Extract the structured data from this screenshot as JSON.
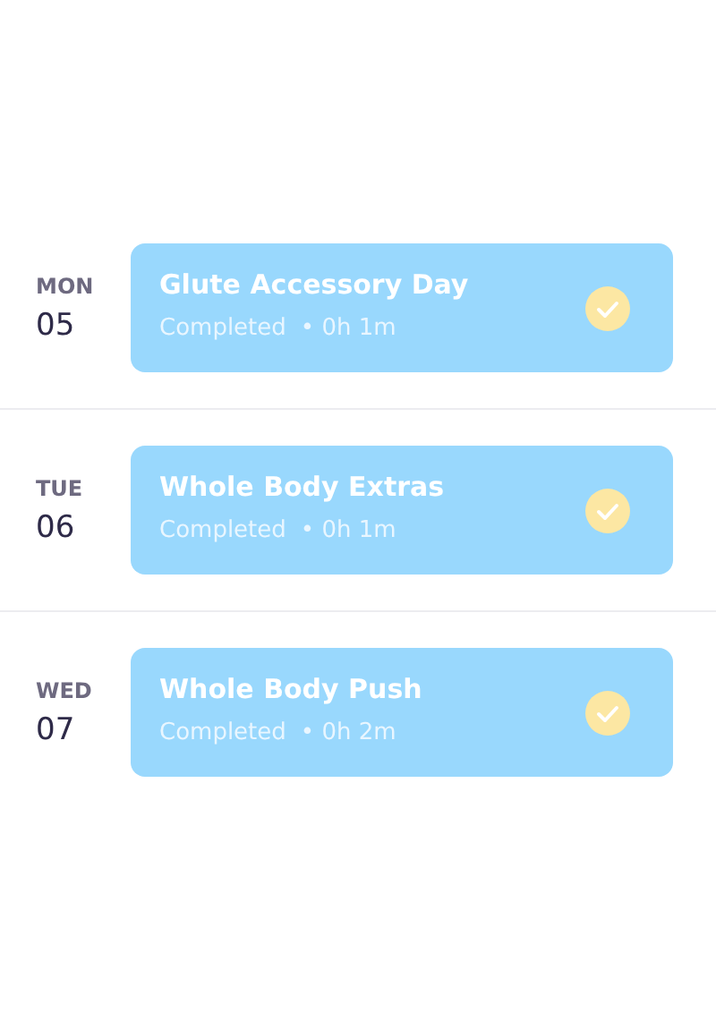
{
  "days": [
    {
      "weekday": "MON",
      "date": "05",
      "workout": {
        "title": "Glute Accessory Day",
        "status": "Completed",
        "duration": "• 0h 1m",
        "completed": true
      }
    },
    {
      "weekday": "TUE",
      "date": "06",
      "workout": {
        "title": "Whole Body Extras",
        "status": "Completed",
        "duration": "• 0h 1m",
        "completed": true
      }
    },
    {
      "weekday": "WED",
      "date": "07",
      "workout": {
        "title": "Whole Body Push",
        "status": "Completed",
        "duration": "• 0h 2m",
        "completed": true
      }
    }
  ]
}
